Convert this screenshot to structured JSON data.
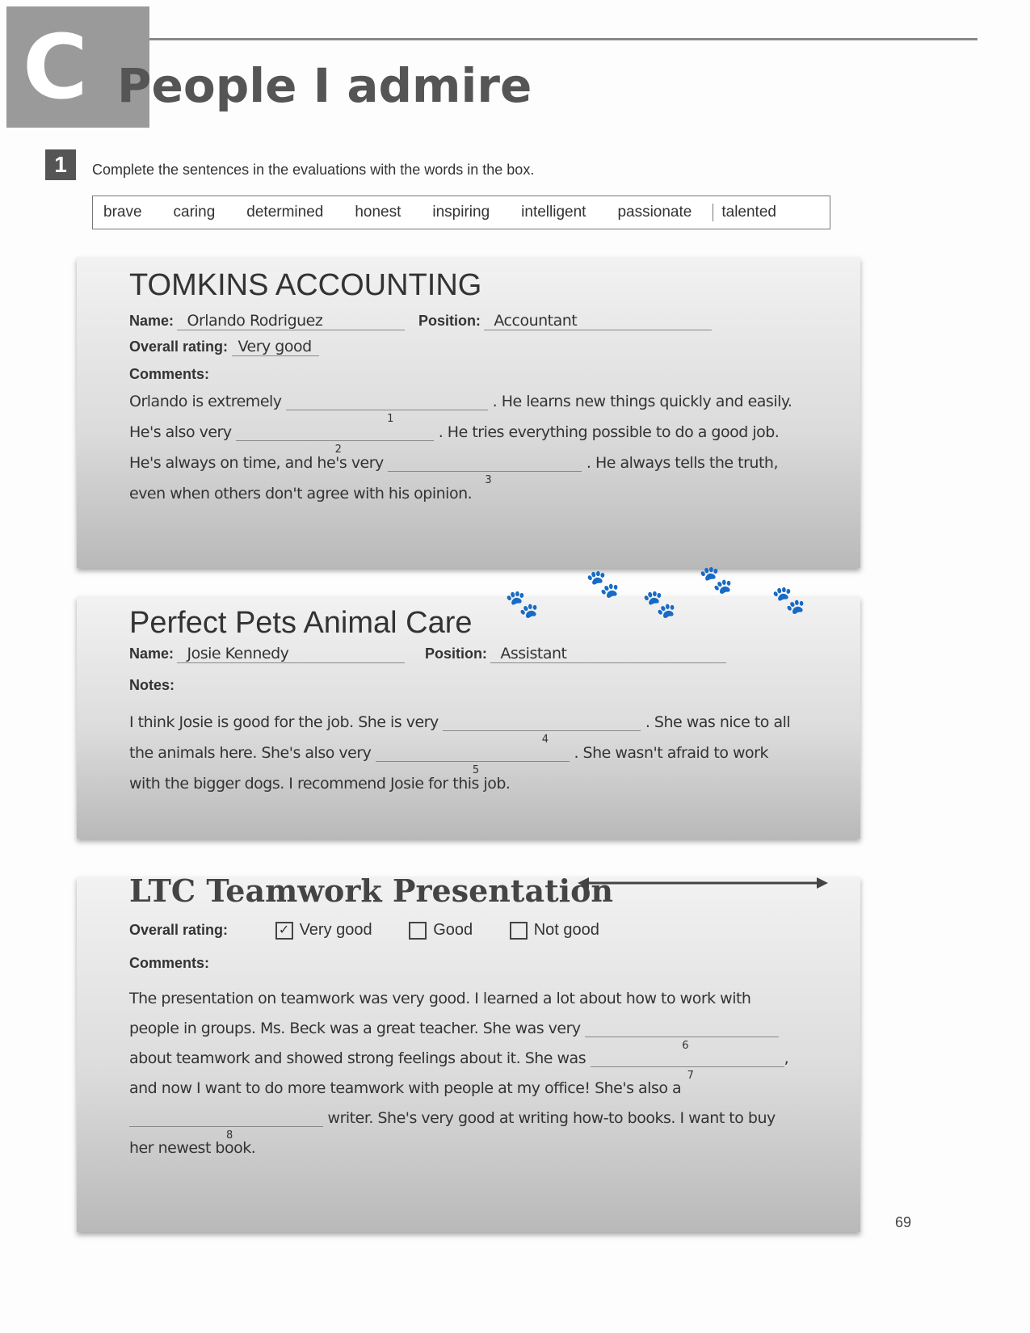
{
  "header": {
    "letter": "C",
    "title": "People I admire"
  },
  "exercise": {
    "number": "1",
    "instruction": "Complete the sentences in the evaluations with the words in the box.",
    "words": [
      "brave",
      "caring",
      "determined",
      "honest",
      "inspiring",
      "intelligent",
      "passionate",
      "talented"
    ]
  },
  "card1": {
    "company": "TOMKINS ACCOUNTING",
    "name_label": "Name:",
    "name": "Orlando Rodriguez",
    "position_label": "Position:",
    "position": "Accountant",
    "rating_label": "Overall rating:",
    "rating": "Very good",
    "comments_label": "Comments:",
    "l1a": "Orlando is extremely",
    "n1": "1",
    "l1b": ". He learns new things quickly and easily.",
    "l2a": "He's also very",
    "n2": "2",
    "l2b": ". He tries everything possible to do a good job.",
    "l3a": "He's always on time, and he's very",
    "n3": "3",
    "l3b": ". He always tells the truth,",
    "l4": "even when others don't agree with his opinion."
  },
  "card2": {
    "company": "Perfect Pets Animal Care",
    "name_label": "Name:",
    "name": "Josie Kennedy",
    "position_label": "Position:",
    "position": "Assistant",
    "notes_label": "Notes:",
    "l1a": "I think Josie is good for the job. She is very",
    "n4": "4",
    "l1b": ". She was nice to all",
    "l2a": "the animals here.  She's also very",
    "n5": "5",
    "l2b": ". She wasn't afraid to work",
    "l3": "with the bigger dogs. I recommend Josie for this job."
  },
  "card3": {
    "title": "LTC Teamwork Presentation",
    "rating_label": "Overall rating:",
    "options": [
      {
        "label": "Very good",
        "checked": true
      },
      {
        "label": "Good",
        "checked": false
      },
      {
        "label": "Not good",
        "checked": false
      }
    ],
    "comments_label": "Comments:",
    "l1": "The presentation on teamwork was very good. I learned a lot about how to work with",
    "l2": "people in groups. Ms. Beck was a great teacher. She was very",
    "n6": "6",
    "l3": "about teamwork and showed strong feelings about it. She was",
    "n7": "7",
    "l3b": ",",
    "l4": "and now I want to do more teamwork with people at my office! She's also a",
    "n8": "8",
    "l5": "writer. She's very good at writing how-to books. I want to buy",
    "l6": "her newest book."
  },
  "page_number": "69"
}
